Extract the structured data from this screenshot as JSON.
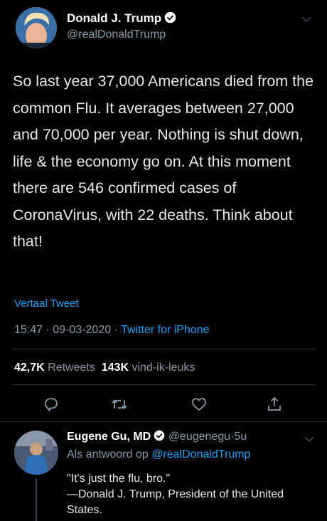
{
  "tweet": {
    "author_name": "Donald J. Trump",
    "author_handle": "@realDonaldTrump",
    "text": "So last year 37,000 Americans died from the common Flu. It averages between 27,000 and 70,000 per year. Nothing is shut down, life & the economy go on. At this moment there are 546 confirmed cases of CoronaVirus, with 22 deaths. Think about that!",
    "translate_label": "Vertaal Tweet",
    "time": "15:47",
    "date": "09-03-2020",
    "separator": "·",
    "source": "Twitter for iPhone",
    "retweets_count": "42,7K",
    "retweets_label": "Retweets",
    "likes_count": "143K",
    "likes_label": "vind-ik-leuks"
  },
  "actions": [
    {
      "name": "reply-icon"
    },
    {
      "name": "retweet-icon"
    },
    {
      "name": "like-icon"
    },
    {
      "name": "share-icon"
    }
  ],
  "reply": {
    "author_name": "Eugene Gu, MD",
    "author_handle": "@eugenegu",
    "separator": "·",
    "age": "5u",
    "reply_prefix": "Als antwoord op",
    "reply_mention": "@realDonaldTrump",
    "text": "\"It's just the flu, bro.\"\n—Donald J. Trump, President of the United States."
  },
  "colors": {
    "background": "#000000",
    "accent": "#1da1f2",
    "muted": "#8899a6"
  }
}
